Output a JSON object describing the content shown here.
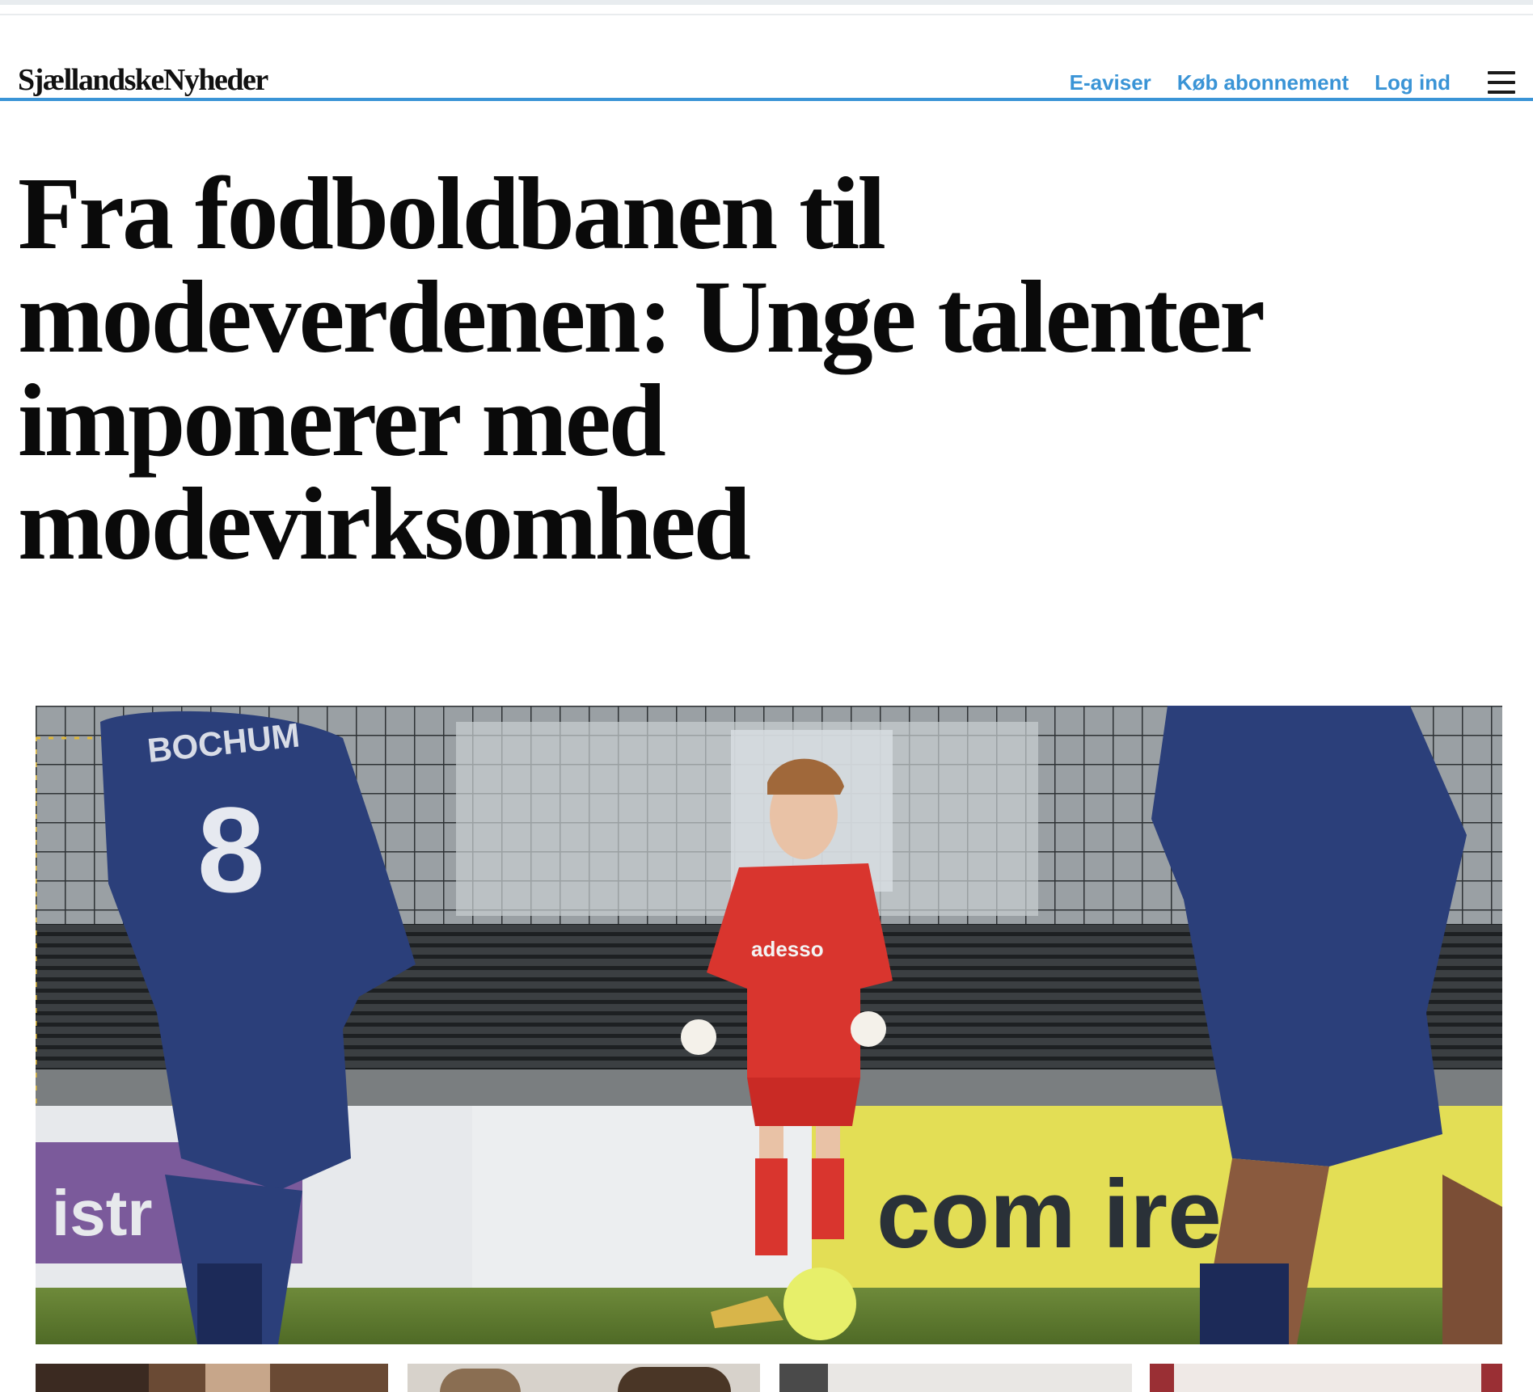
{
  "site": {
    "logo_text": "SjællandskeNyheder"
  },
  "nav": {
    "eaviser": "E-aviser",
    "subscribe": "Køb abonnement",
    "login": "Log ind"
  },
  "article": {
    "headline_lines": [
      "Fra fodboldbanen til",
      "modeverdenen: Unge talenter",
      "imponerer med",
      "modevirksomhed"
    ]
  },
  "hero_image": {
    "shirt_left_text": "BOCHUM",
    "shirt_left_number": "8",
    "keeper_shirt_text": "adesso",
    "sponsor_board_text": "com  ire",
    "left_board_text": "istr"
  },
  "colors": {
    "brand_blue": "#3a94d6",
    "headline": "#0a0a0a",
    "bochum_blue": "#2b3f7a",
    "keeper_red": "#d9352e"
  }
}
